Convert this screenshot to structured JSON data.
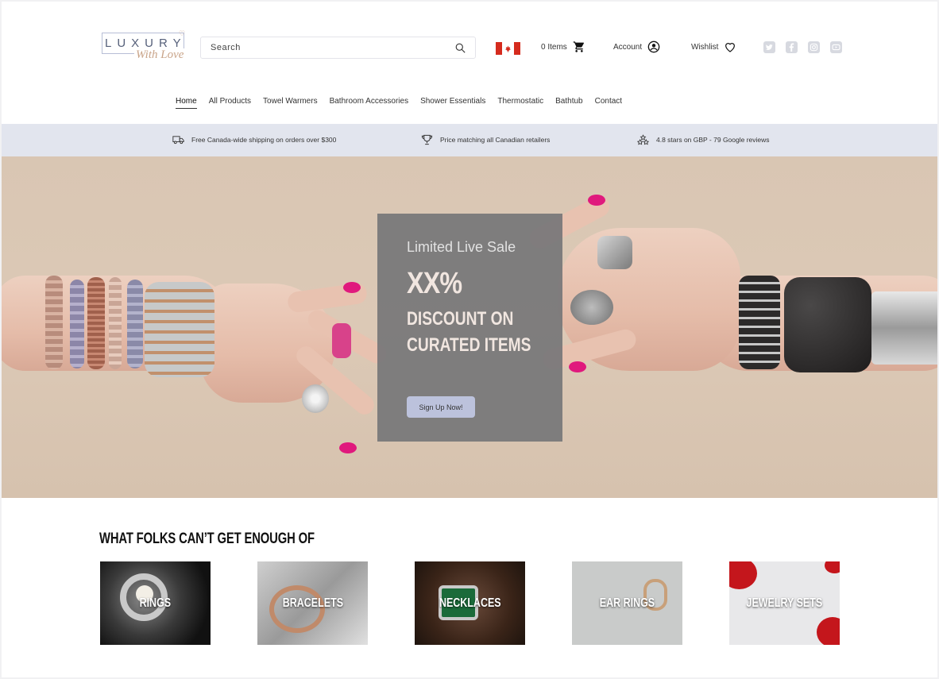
{
  "brand": {
    "logo_word": "LUXURY",
    "logo_script": "With Love"
  },
  "search": {
    "placeholder": "Search"
  },
  "header": {
    "cart_label": "0 Items",
    "account_label": "Account",
    "wishlist_label": "Wishlist",
    "flag": "canada-flag-icon",
    "social_icons": [
      "twitter-icon",
      "facebook-icon",
      "instagram-icon",
      "youtube-icon"
    ]
  },
  "nav": {
    "items": [
      {
        "label": "Home",
        "active": true
      },
      {
        "label": "All Products"
      },
      {
        "label": "Towel Warmers"
      },
      {
        "label": "Bathroom Accessories"
      },
      {
        "label": "Shower Essentials"
      },
      {
        "label": "Thermostatic"
      },
      {
        "label": "Bathtub"
      },
      {
        "label": "Contact"
      }
    ]
  },
  "infobar": {
    "shipping": "Free Canada-wide shipping on orders over $300",
    "price_match": "Price matching all Canadian retailers",
    "reviews": "4.8 stars on GBP - 79 Google reviews"
  },
  "hero": {
    "tag": "Limited Live Sale",
    "discount": "XX%",
    "line1": "DISCOUNT ON",
    "line2": "CURATED ITEMS",
    "cta": "Sign Up Now!"
  },
  "categories": {
    "title": "WHAT FOLKS CAN’T GET ENOUGH OF",
    "items": [
      {
        "label": "RINGS"
      },
      {
        "label": "BRACELETS"
      },
      {
        "label": "NECKLACES"
      },
      {
        "label": "EAR RINGS"
      },
      {
        "label": "JEWELRY SETS"
      }
    ]
  },
  "colors": {
    "infobar_bg": "#e2e5ee",
    "hero_bg": "#d9c6b3",
    "promo_overlay": "#767678",
    "cta_bg": "#bcc2dc",
    "nail_pink": "#e0197d"
  }
}
